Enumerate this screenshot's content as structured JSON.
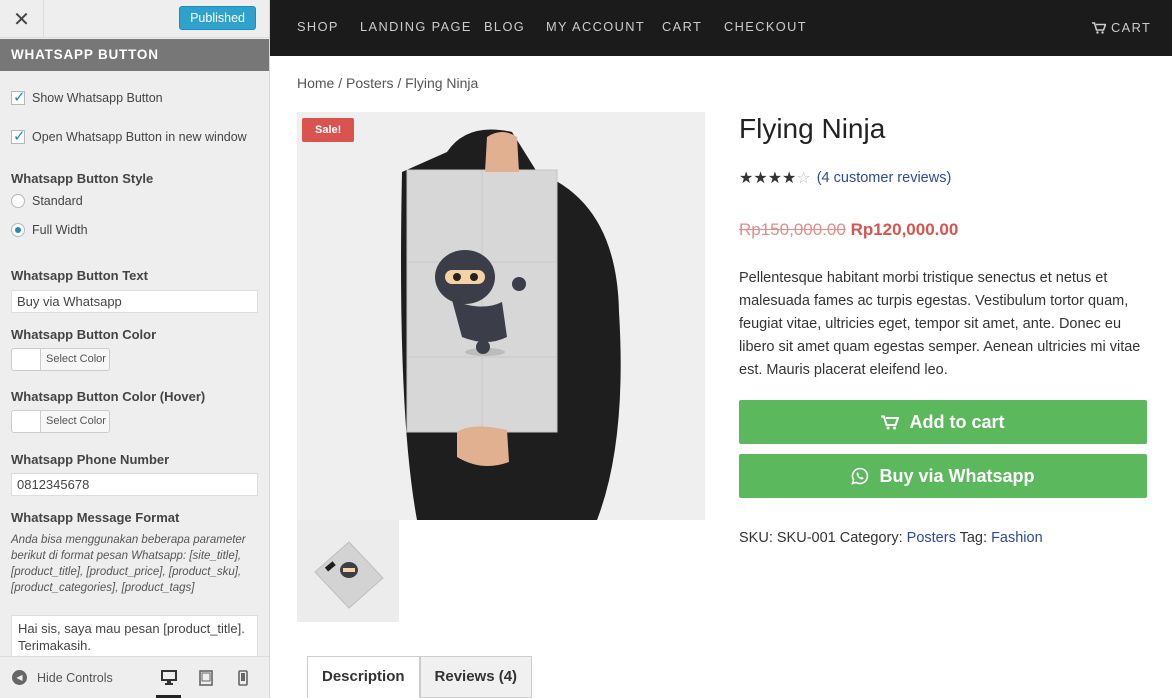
{
  "customizer": {
    "publish_label": "Published",
    "section_title": "WHATSAPP BUTTON",
    "show_button_label": "Show Whatsapp Button",
    "show_button_checked": true,
    "new_window_label": "Open Whatsapp Button in new window",
    "new_window_checked": true,
    "style_label": "Whatsapp Button Style",
    "style_options": [
      "Standard",
      "Full Width"
    ],
    "style_selected": "Full Width",
    "text_label": "Whatsapp Button Text",
    "text_value": "Buy via Whatsapp",
    "color_label": "Whatsapp Button Color",
    "color_hover_label": "Whatsapp Button Color (Hover)",
    "select_color_label": "Select Color",
    "phone_label": "Whatsapp Phone Number",
    "phone_value": "0812345678",
    "message_label": "Whatsapp Message Format",
    "message_help": "Anda bisa menggunakan beberapa parameter berikut di format pesan Whatsapp: [site_title], [product_title], [product_price], [product_sku], [product_categories], [product_tags]",
    "message_value": "Hai sis, saya mau pesan [product_title]. Terimakasih.",
    "hide_controls_label": "Hide Controls",
    "devices": [
      "desktop-icon",
      "tablet-icon",
      "mobile-icon"
    ],
    "active_device": "desktop"
  },
  "site": {
    "nav": [
      "SHOP",
      "LANDING PAGE",
      "BLOG",
      "MY ACCOUNT",
      "CART",
      "CHECKOUT"
    ],
    "cart_label": "CART",
    "breadcrumb": [
      "Home",
      "Posters",
      "Flying Ninja"
    ],
    "sale_badge": "Sale!",
    "product_title": "Flying Ninja",
    "rating": 4,
    "rating_max": 5,
    "reviews_text": "(4 customer reviews)",
    "old_price": "Rp150,000.00",
    "new_price": "Rp120,000.00",
    "description": "Pellentesque habitant morbi tristique senectus et netus et malesuada fames ac turpis egestas. Vestibulum tortor quam, feugiat vitae, ultricies eget, tempor sit amet, ante. Donec eu libero sit amet quam egestas semper. Aenean ultricies mi vitae est. Mauris placerat eleifend leo.",
    "add_to_cart": "Add to cart",
    "whatsapp_button": "Buy via Whatsapp",
    "sku_label": "SKU:",
    "sku_value": "SKU-001",
    "category_label": "Category:",
    "category_value": "Posters",
    "tag_label": "Tag:",
    "tag_value": "Fashion",
    "tabs": [
      "Description",
      "Reviews (4)"
    ],
    "active_tab": "Description"
  },
  "colors": {
    "button_green": "#5cb85c",
    "sale_red": "#d9534f",
    "nav_bg": "#1b1b1b",
    "publish_blue": "#2ea2cc",
    "link_blue": "#2b4a99"
  }
}
